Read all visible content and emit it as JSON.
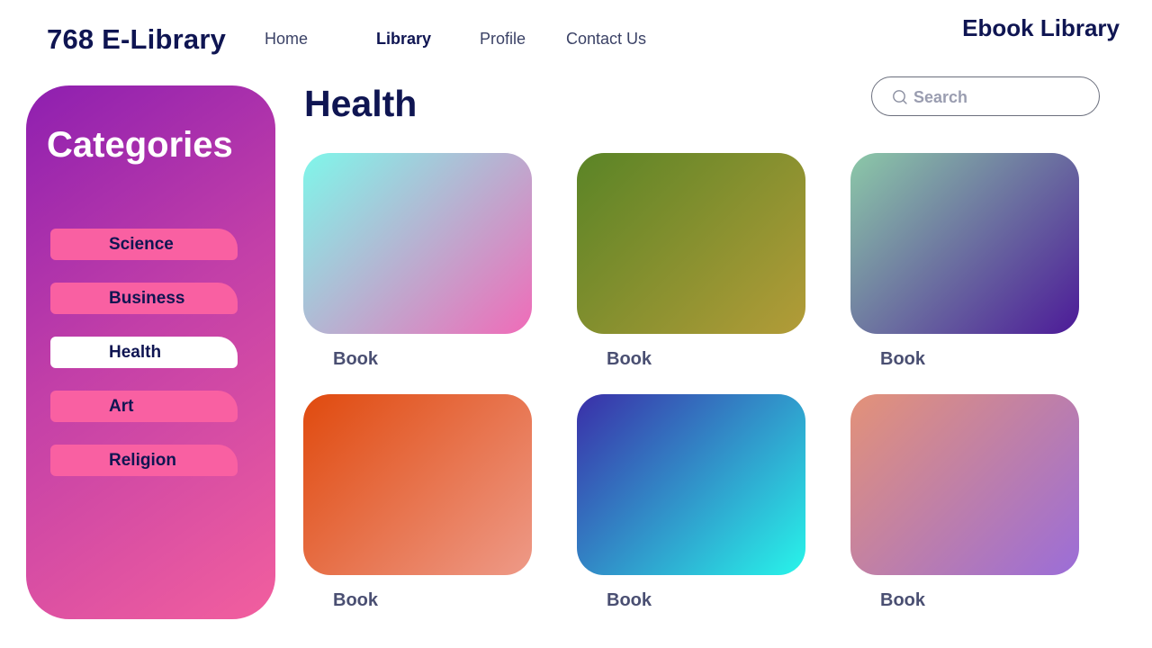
{
  "header": {
    "logo": "768 E-Library",
    "brand": "Ebook Library",
    "nav": [
      {
        "label": "Home",
        "active": false
      },
      {
        "label": "Library",
        "active": true
      },
      {
        "label": "Profile",
        "active": false
      },
      {
        "label": "Contact Us",
        "active": false
      }
    ]
  },
  "sidebar": {
    "title": "Categories",
    "items": [
      {
        "label": "Science",
        "active": false
      },
      {
        "label": "Business",
        "active": false
      },
      {
        "label": "Health",
        "active": true
      },
      {
        "label": "Art",
        "active": false
      },
      {
        "label": "Religion",
        "active": false
      }
    ]
  },
  "main": {
    "title": "Health",
    "search": {
      "placeholder": "Search",
      "value": ""
    },
    "books": [
      {
        "label": "Book",
        "gradient": [
          "#7ff7ea",
          "#f06bb8"
        ]
      },
      {
        "label": "Book",
        "gradient": [
          "#5a8426",
          "#b39c38"
        ]
      },
      {
        "label": "Book",
        "gradient": [
          "#8cc9a8",
          "#4c1a98"
        ]
      },
      {
        "label": "Book",
        "gradient": [
          "#e04a0e",
          "#ee9a88"
        ]
      },
      {
        "label": "Book",
        "gradient": [
          "#3a2ea8",
          "#28f5ea"
        ]
      },
      {
        "label": "Book",
        "gradient": [
          "#e39278",
          "#9b6dd8"
        ]
      }
    ]
  },
  "colors": {
    "primary_text": "#0f1552",
    "category_pill": "#f960a2",
    "sidebar_gradient": [
      "#8e1fb0",
      "#f25f9e"
    ]
  }
}
